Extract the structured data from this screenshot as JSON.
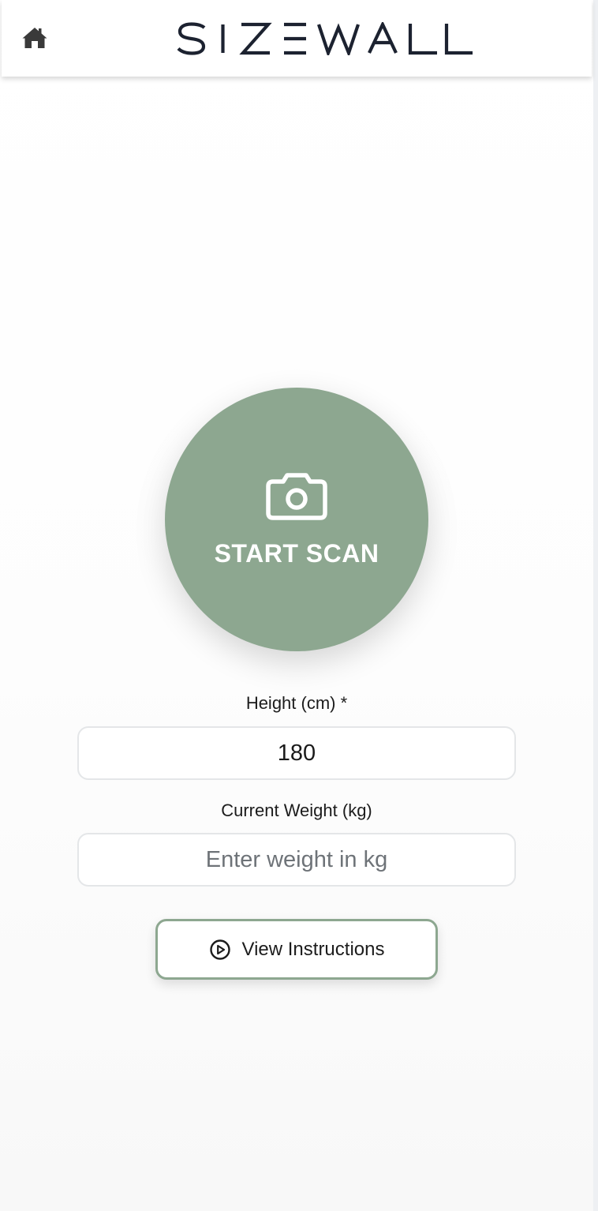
{
  "header": {
    "home_icon": "home-icon",
    "brand": "SIZEWALL"
  },
  "scan": {
    "icon": "camera-icon",
    "label": "START SCAN",
    "color": "#8da790"
  },
  "form": {
    "height": {
      "label": "Height (cm) *",
      "value": "180"
    },
    "weight": {
      "label": "Current Weight (kg)",
      "value": "",
      "placeholder": "Enter weight in kg"
    }
  },
  "instructions": {
    "icon": "play-circle-icon",
    "label": "View Instructions"
  }
}
